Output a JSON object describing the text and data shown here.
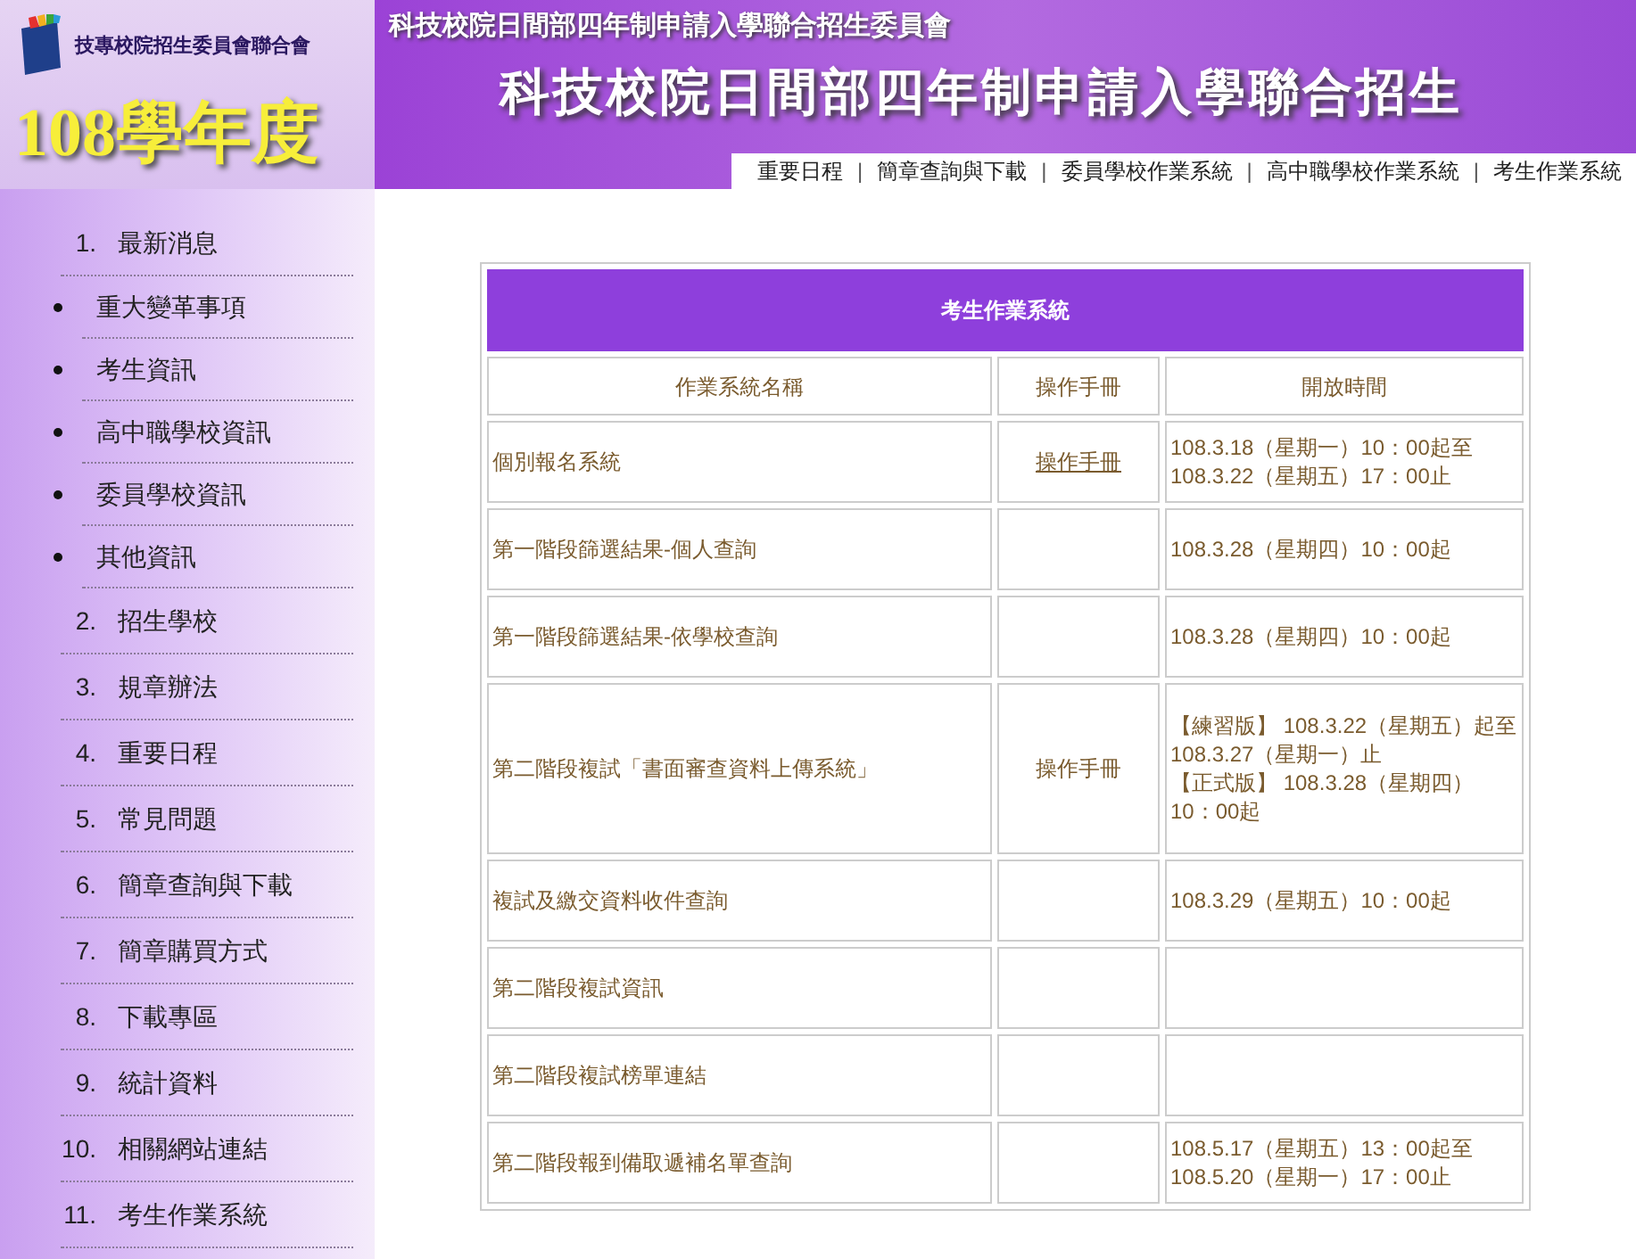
{
  "header": {
    "org_name": "技專校院招生委員會聯合會",
    "year": "108學年度",
    "org_banner": "科技校院日間部四年制申請入學聯合招生委員會",
    "title": "科技校院日間部四年制申請入學聯合招生",
    "nav": [
      "重要日程",
      "簡章查詢與下載",
      "委員學校作業系統",
      "高中職學校作業系統",
      "考生作業系統"
    ],
    "separator": "|"
  },
  "sidebar": {
    "items": [
      {
        "number": "1.",
        "label": "最新消息",
        "children": [
          {
            "label": "重大變革事項"
          },
          {
            "label": "考生資訊"
          },
          {
            "label": "高中職學校資訊"
          },
          {
            "label": "委員學校資訊"
          },
          {
            "label": "其他資訊"
          }
        ]
      },
      {
        "number": "2.",
        "label": "招生學校"
      },
      {
        "number": "3.",
        "label": "規章辦法"
      },
      {
        "number": "4.",
        "label": "重要日程"
      },
      {
        "number": "5.",
        "label": "常見問題"
      },
      {
        "number": "6.",
        "label": "簡章查詢與下載"
      },
      {
        "number": "7.",
        "label": "簡章購買方式"
      },
      {
        "number": "8.",
        "label": "下載專區"
      },
      {
        "number": "9.",
        "label": "統計資料"
      },
      {
        "number": "10.",
        "label": "相關網站連結"
      },
      {
        "number": "11.",
        "label": "考生作業系統"
      }
    ]
  },
  "table": {
    "title": "考生作業系統",
    "columns": [
      "作業系統名稱",
      "操作手冊",
      "開放時間"
    ],
    "rows": [
      {
        "name": "個別報名系統",
        "manual": {
          "text": "操作手冊",
          "link": true
        },
        "time": [
          "108.3.18（星期一）10：00起至",
          "108.3.22（星期五）17：00止"
        ]
      },
      {
        "name": "第一階段篩選結果-個人查詢",
        "time": [
          "108.3.28（星期四）10：00起"
        ]
      },
      {
        "name": "第一階段篩選結果-依學校查詢",
        "time": [
          "108.3.28（星期四）10：00起"
        ]
      },
      {
        "name": "第二階段複試「書面審查資料上傳系統」",
        "manual": {
          "text": "操作手冊",
          "link": false
        },
        "time": [
          "【練習版】 108.3.22（星期五）起至 108.3.27（星期一）止",
          "【正式版】 108.3.28（星期四）10：00起"
        ]
      },
      {
        "name": "複試及繳交資料收件查詢",
        "time": [
          "108.3.29（星期五）10：00起"
        ]
      },
      {
        "name": "第二階段複試資訊"
      },
      {
        "name": "第二階段複試榜單連結"
      },
      {
        "name": "第二階段報到備取遞補名單查詢",
        "time": [
          "108.5.17（星期五）13：00起至",
          "108.5.20（星期一）17：00止"
        ]
      }
    ]
  }
}
